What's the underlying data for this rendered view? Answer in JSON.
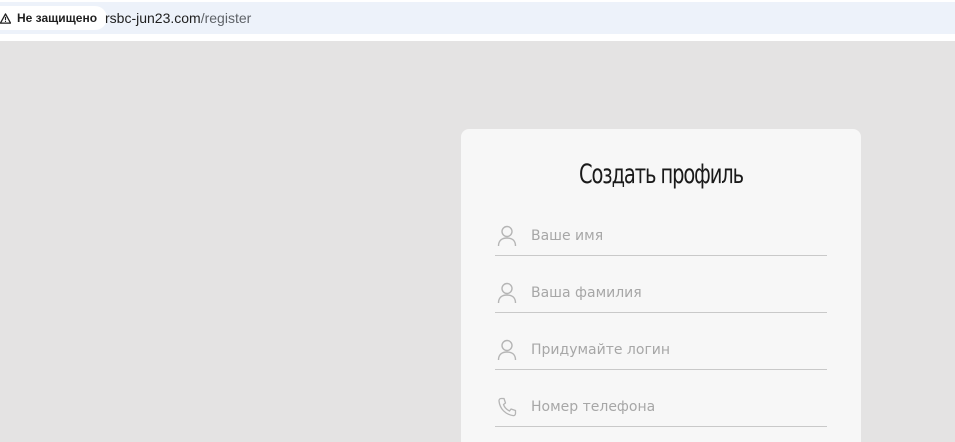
{
  "browser": {
    "security_label": "Не защищено",
    "url_host": "rsbc-jun23.com",
    "url_path": "/register"
  },
  "form": {
    "title": "Создать профиль",
    "fields": [
      {
        "placeholder": "Ваше имя",
        "icon": "user-icon"
      },
      {
        "placeholder": "Ваша фамилия",
        "icon": "user-icon"
      },
      {
        "placeholder": "Придумайте логин",
        "icon": "user-icon"
      },
      {
        "placeholder": "Номер телефона",
        "icon": "phone-icon"
      }
    ]
  },
  "colors": {
    "page_background": "#e4e3e3",
    "card_background": "#f7f7f7",
    "placeholder": "#a7a7a7",
    "url_field": "#edf2fa"
  }
}
